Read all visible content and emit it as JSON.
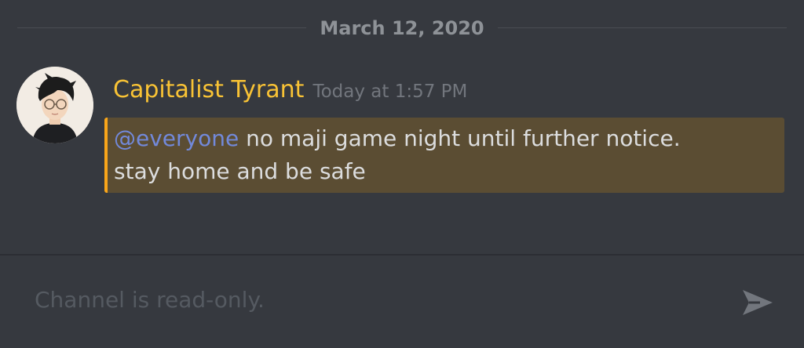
{
  "divider": {
    "date": "March 12, 2020"
  },
  "message": {
    "author": "Capitalist Tyrant",
    "timestamp": "Today at 1:57 PM",
    "mention": "@everyone",
    "text_line1": " no maji game night until further notice.",
    "text_line2": "stay home and be safe"
  },
  "composer": {
    "placeholder": "Channel is read-only.",
    "send_icon": "send-icon"
  },
  "colors": {
    "background": "#36393f",
    "username": "#f9c335",
    "mention": "#7289da",
    "highlight_bg": "#5b4d33",
    "highlight_bar": "#faa61a"
  }
}
